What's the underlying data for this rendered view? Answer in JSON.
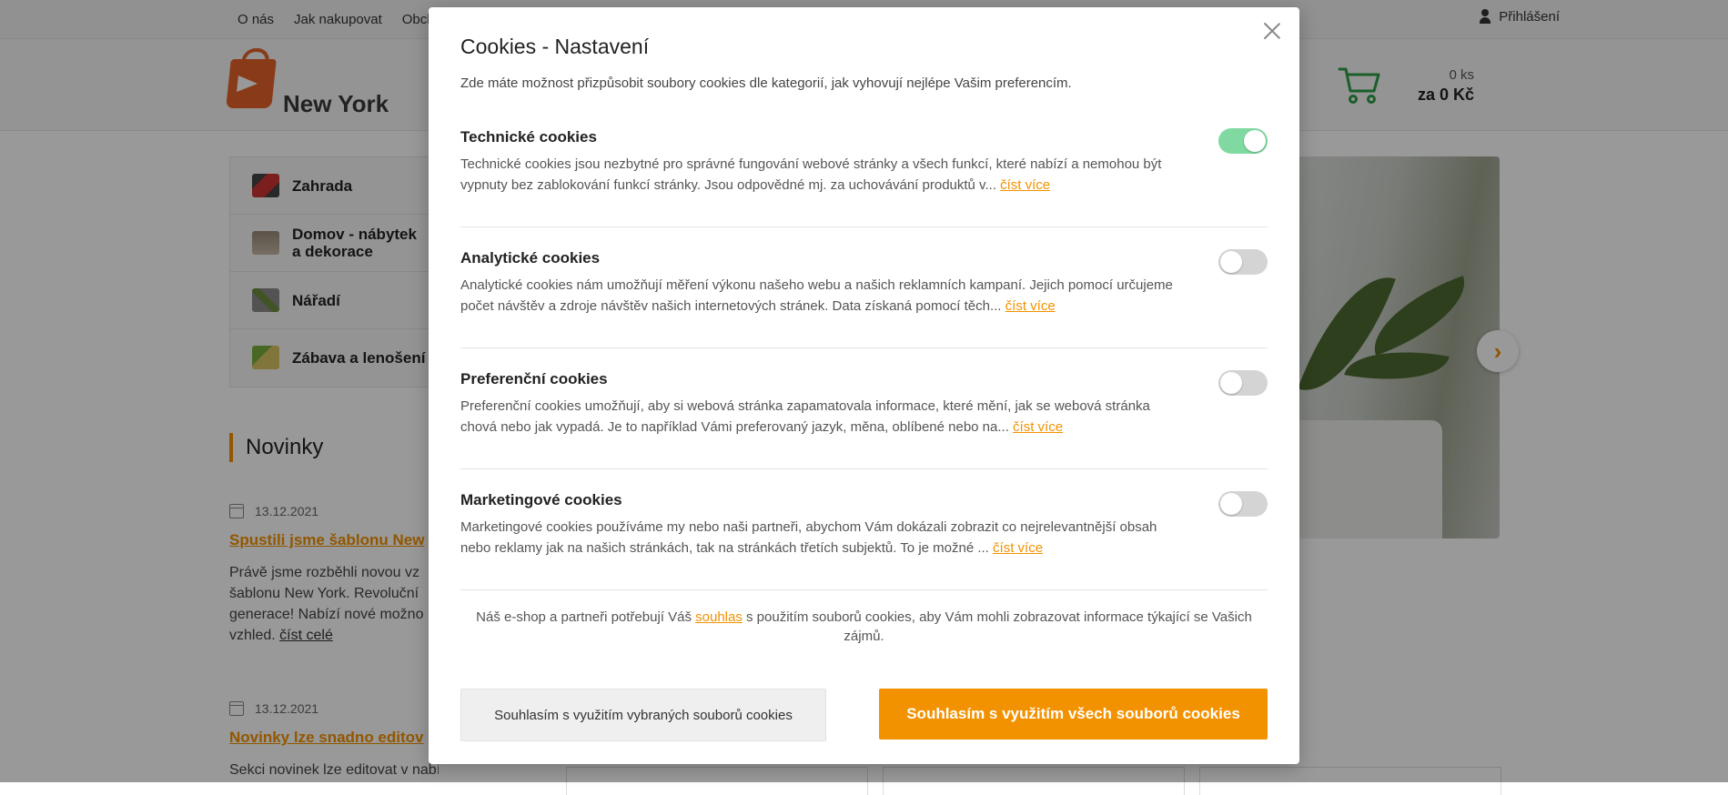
{
  "topnav": {
    "items": [
      "O nás",
      "Jak nakupovat",
      "Obch"
    ],
    "login": "Přihlášení"
  },
  "header": {
    "logo_text": "New York",
    "cart_qty": "0 ks",
    "cart_price": "za 0 Kč"
  },
  "categories": [
    {
      "label": "Zahrada"
    },
    {
      "label": "Domov - nábytek a dekorace"
    },
    {
      "label": "Nářadí"
    },
    {
      "label": "Zábava a lenošení"
    }
  ],
  "news": {
    "title": "Novinky",
    "items": [
      {
        "date": "13.12.2021",
        "title": "Spustili jsme šablonu New",
        "text": [
          "Právě jsme rozběhli novou vz",
          "šablonu New York. Revoluční",
          "generace! Nabízí nové možno",
          "vzhled."
        ],
        "more": "číst celé"
      },
      {
        "date": "13.12.2021",
        "title": "Novinky lze snadno editov",
        "text": [
          "Sekci novinek lze editovat v nabídce Obsah"
        ]
      }
    ]
  },
  "modal": {
    "title": "Cookies - Nastavení",
    "subtitle": "Zde máte možnost přizpůsobit soubory cookies dle kategorií, jak vyhovují nejlépe Vašim preferencím.",
    "sections": [
      {
        "title": "Technické cookies",
        "enabled": true,
        "text": "Technické cookies jsou nezbytné pro správné fungování webové stránky a všech funkcí, které nabízí a nemohou být vypnuty bez zablokování funkcí stránky. Jsou odpovědné mj. za uchovávání produktů v...",
        "more": "číst více"
      },
      {
        "title": "Analytické cookies",
        "enabled": false,
        "text": "Analytické cookies nám umožňují měření výkonu našeho webu a našich reklamních kampaní. Jejich pomocí určujeme počet návštěv a zdroje návštěv našich internetových stránek. Data získaná pomocí těch...",
        "more": "číst více"
      },
      {
        "title": "Preferenční cookies",
        "enabled": false,
        "text": "Preferenční cookies umožňují, aby si webová stránka zapamatovala informace, které mění, jak se webová stránka chová nebo jak vypadá. Je to například Vámi preferovaný jazyk, měna, oblíbené nebo na...",
        "more": "číst více"
      },
      {
        "title": "Marketingové cookies",
        "enabled": false,
        "text": "Marketingové cookies používáme my nebo naši partneři, abychom Vám dokázali zobrazit co nejrelevantnější obsah nebo reklamy jak na našich stránkách, tak na stránkách třetích subjektů. To je možné ...",
        "more": "číst více"
      }
    ],
    "consent_before": "Náš e-shop a partneři potřebují Váš ",
    "consent_link": "souhlas",
    "consent_after": " s použitím souborů cookies, aby Vám mohli zobrazovat informace týkající se Vašich zájmů.",
    "btn_selected": "Souhlasím s využitím vybraných souborů cookies",
    "btn_all": "Souhlasím s využitím všech souborů cookies"
  },
  "colors": {
    "accent": "#f39200",
    "toggle_on": "#7fd9a1",
    "toggle_off": "#d4d4d4",
    "logo": "#e4632a",
    "cart": "#2e9d46"
  }
}
